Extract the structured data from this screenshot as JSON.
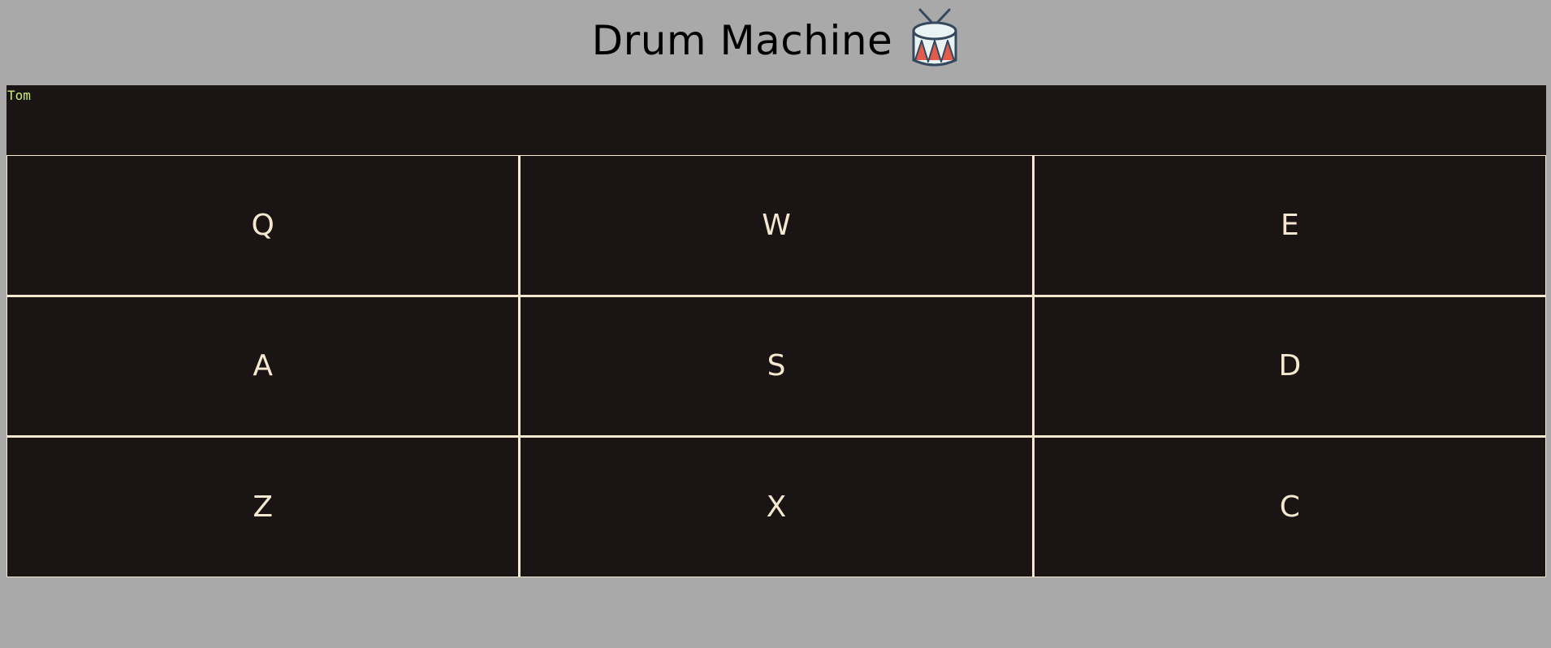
{
  "header": {
    "title": "Drum Machine",
    "icon": "drum-icon"
  },
  "display": {
    "text": "Tom"
  },
  "colors": {
    "page_background": "#a9a9a9",
    "panel_background": "#1a1414",
    "pad_border": "#f6e7cf",
    "pad_text": "#f6e7cf",
    "display_text": "#c6f26b"
  },
  "pads": [
    {
      "key": "Q"
    },
    {
      "key": "W"
    },
    {
      "key": "E"
    },
    {
      "key": "A"
    },
    {
      "key": "S"
    },
    {
      "key": "D"
    },
    {
      "key": "Z"
    },
    {
      "key": "X"
    },
    {
      "key": "C"
    }
  ]
}
